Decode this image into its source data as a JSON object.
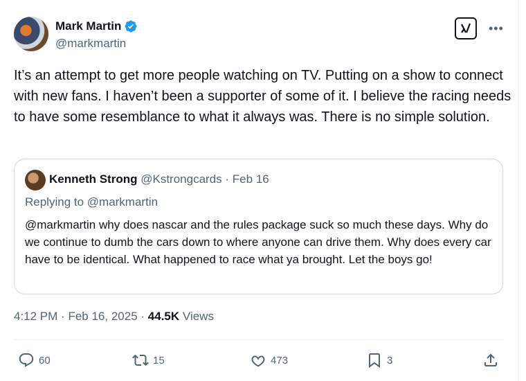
{
  "author": {
    "display_name": "Mark Martin",
    "handle": "@markmartin",
    "verified": true
  },
  "tweet": {
    "text": "It’s an attempt to get more people watching on TV. Putting on a show to connect with new fans. I haven’t been a supporter of some of it. I believe the racing needs to have some resemblance to what it always was. There is no simple solution."
  },
  "quote": {
    "display_name": "Kenneth Strong",
    "handle": "@Kstrongcards",
    "separator": "·",
    "date": "Feb 16",
    "replying_to": "Replying to @markmartin",
    "text": "@markmartin why does nascar and the rules package suck so much these days. Why do we continue to dumb the cars down to where anyone can drive them. Why does every car have to be identical. What happened to race what ya brought. Let the boys go!"
  },
  "meta": {
    "time": "4:12 PM",
    "separator": "·",
    "date": "Feb 16, 2025",
    "views_count": "44.5K",
    "views_label": "Views"
  },
  "actions": {
    "replies": "60",
    "reposts": "15",
    "likes": "473",
    "bookmarks": "3"
  },
  "colors": {
    "verified": "#1d9bf0",
    "secondary_text": "#536471",
    "border": "#cfd9de"
  },
  "icons": {
    "grok": "grok-icon",
    "more": "more-icon",
    "reply": "reply-icon",
    "repost": "repost-icon",
    "like": "heart-icon",
    "bookmark": "bookmark-icon",
    "share": "share-icon"
  }
}
